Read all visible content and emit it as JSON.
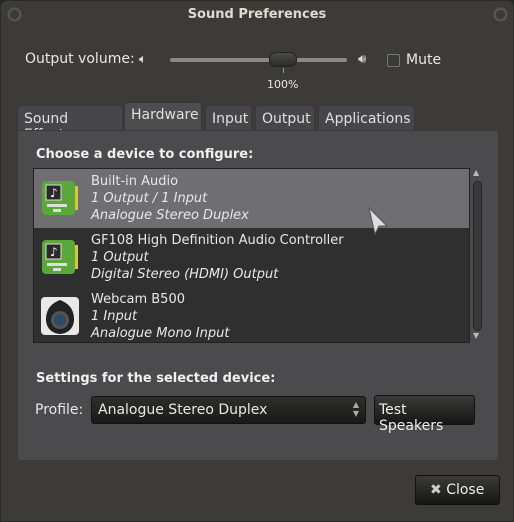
{
  "window": {
    "title": "Sound Preferences"
  },
  "volume": {
    "label": "Output volume:",
    "value_percent": 100,
    "value_text": "100%",
    "mute_label": "Mute",
    "muted": false
  },
  "tabs": [
    {
      "label": "Sound Effects"
    },
    {
      "label": "Hardware",
      "active": true
    },
    {
      "label": "Input"
    },
    {
      "label": "Output"
    },
    {
      "label": "Applications"
    }
  ],
  "hardware": {
    "choose_heading": "Choose a device to configure:",
    "devices": [
      {
        "name": "Built-in Audio",
        "ports": "1 Output / 1 Input",
        "profile": "Analogue Stereo Duplex",
        "icon": "sound-card-icon",
        "selected": true
      },
      {
        "name": "GF108 High Definition Audio Controller",
        "ports": "1 Output",
        "profile": "Digital Stereo (HDMI) Output",
        "icon": "sound-card-icon"
      },
      {
        "name": "Webcam B500",
        "ports": "1 Input",
        "profile": "Analogue Mono Input",
        "icon": "webcam-icon"
      }
    ],
    "settings_heading": "Settings for the selected device:",
    "profile_label": "Profile:",
    "profile_value": "Analogue Stereo Duplex",
    "test_button": "Test Speakers"
  },
  "close_button": "Close",
  "colors": {
    "window_bg": "#3c3b37",
    "selection": "#6f6e71",
    "card_green": "#5aa83a"
  }
}
